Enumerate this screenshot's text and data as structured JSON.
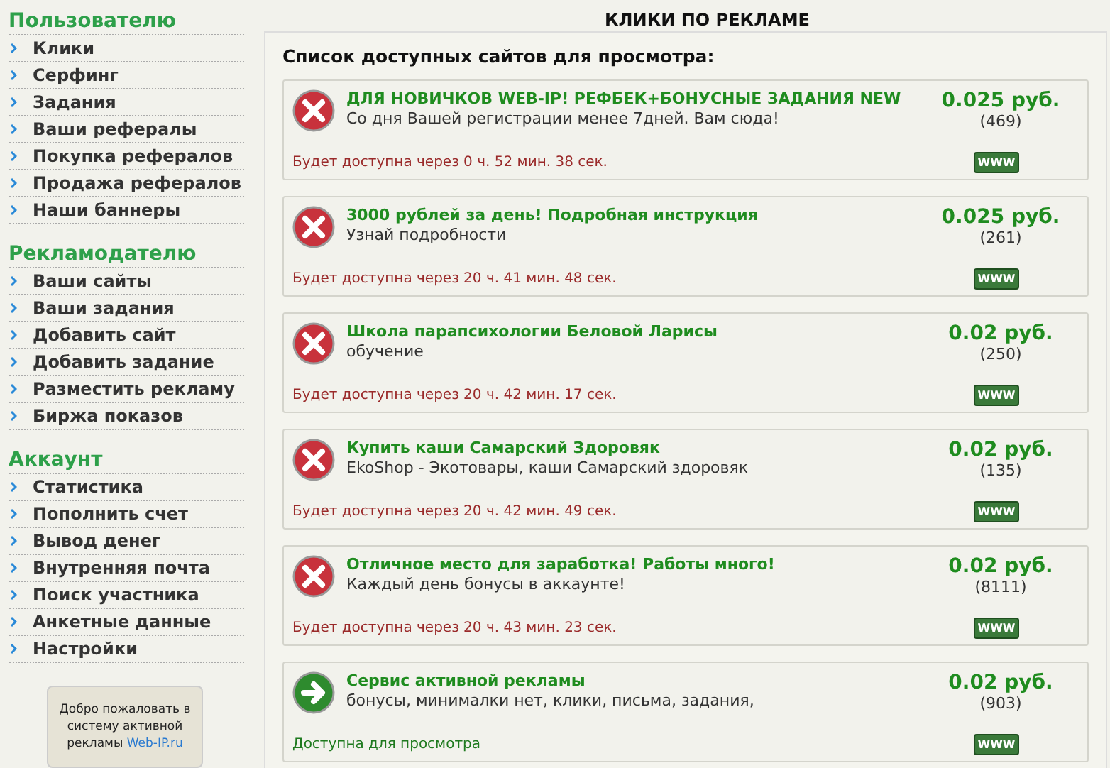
{
  "sidebar": {
    "sections": [
      {
        "title": "Пользователю",
        "items": [
          "Клики",
          "Серфинг",
          "Задания",
          "Ваши рефералы",
          "Покупка рефералов",
          "Продажа рефералов",
          "Наши баннеры"
        ]
      },
      {
        "title": "Рекламодателю",
        "items": [
          "Ваши сайты",
          "Ваши задания",
          "Добавить сайт",
          "Добавить задание",
          "Разместить рекламу",
          "Биржа показов"
        ]
      },
      {
        "title": "Аккаунт",
        "items": [
          "Статистика",
          "Пополнить счет",
          "Вывод денег",
          "Внутренняя почта",
          "Поиск участника",
          "Анкетные данные",
          "Настройки"
        ]
      }
    ],
    "banner": {
      "text": "Добро пожаловать в систему активной рекламы",
      "link": "Web-IP.ru"
    }
  },
  "page_title": "КЛИКИ ПО РЕКЛАМЕ",
  "list_title": "Список доступных сайтов для просмотра:",
  "sites": [
    {
      "kind": "waiting",
      "title": "ДЛЯ НОВИЧКОВ WEB-IP! РЕФБЕК+БОНУСНЫЕ ЗАДАНИЯ NEW",
      "description": "Со дня Вашей регистрации менее 7дней. Вам сюда!",
      "price": "0.025 руб.",
      "count": "(469)",
      "status": "Будет доступна через 0 ч. 52 мин. 38 сек.",
      "button": "WWW"
    },
    {
      "kind": "waiting",
      "title": "3000 рублей за день! Подробная инструкция",
      "description": "Узнай подробности",
      "price": "0.025 руб.",
      "count": "(261)",
      "status": "Будет доступна через 20 ч. 41 мин. 48 сек.",
      "button": "WWW"
    },
    {
      "kind": "waiting",
      "title": "Школа парапсихологии Беловой Ларисы",
      "description": "обучение",
      "price": "0.02 руб.",
      "count": "(250)",
      "status": "Будет доступна через 20 ч. 42 мин. 17 сек.",
      "button": "WWW"
    },
    {
      "kind": "waiting",
      "title": "Купить каши Самарский Здоровяк",
      "description": "EkoShop - Экотовары, каши Самарский здоровяк",
      "price": "0.02 руб.",
      "count": "(135)",
      "status": "Будет доступна через 20 ч. 42 мин. 49 сек.",
      "button": "WWW"
    },
    {
      "kind": "waiting",
      "title": "Отличное место для заработка! Работы много!",
      "description": "Каждый день бонусы в аккаунте!",
      "price": "0.02 руб.",
      "count": "(8111)",
      "status": "Будет доступна через 20 ч. 43 мин. 23 сек.",
      "button": "WWW"
    },
    {
      "kind": "available",
      "title": "Сервис активной рекламы",
      "description": "бонусы, минималки нет, клики, письма, задания,",
      "price": "0.02 руб.",
      "count": "(903)",
      "status": "Доступна для просмотра",
      "button": "WWW"
    }
  ]
}
